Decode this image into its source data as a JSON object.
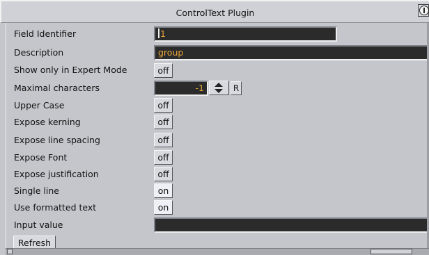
{
  "window": {
    "title": "ControlText Plugin"
  },
  "fields": {
    "field_identifier": {
      "label": "Field Identifier",
      "value": "1"
    },
    "description": {
      "label": "Description",
      "value": "group"
    },
    "show_expert": {
      "label": "Show only in Expert Mode",
      "value": "off"
    },
    "max_chars": {
      "label": "Maximal characters",
      "value": "-1",
      "reset": "R"
    },
    "upper_case": {
      "label": "Upper Case",
      "value": "off"
    },
    "expose_kerning": {
      "label": "Expose kerning",
      "value": "off"
    },
    "expose_line_spacing": {
      "label": "Expose line spacing",
      "value": "off"
    },
    "expose_font": {
      "label": "Expose Font",
      "value": "off"
    },
    "expose_justification": {
      "label": "Expose justification",
      "value": "off"
    },
    "single_line": {
      "label": "Single line",
      "value": "on"
    },
    "use_formatted": {
      "label": "Use formatted text",
      "value": "on"
    },
    "input_value": {
      "label": "Input value",
      "value": ""
    }
  },
  "buttons": {
    "refresh": "Refresh"
  },
  "colors": {
    "field_bg": "#2b2b2b",
    "field_text": "#e9a53a",
    "panel_bg": "#c4c6cc"
  },
  "icons": {
    "title_button": "window-menu-icon",
    "stepper": "spin-arrows-icon"
  }
}
